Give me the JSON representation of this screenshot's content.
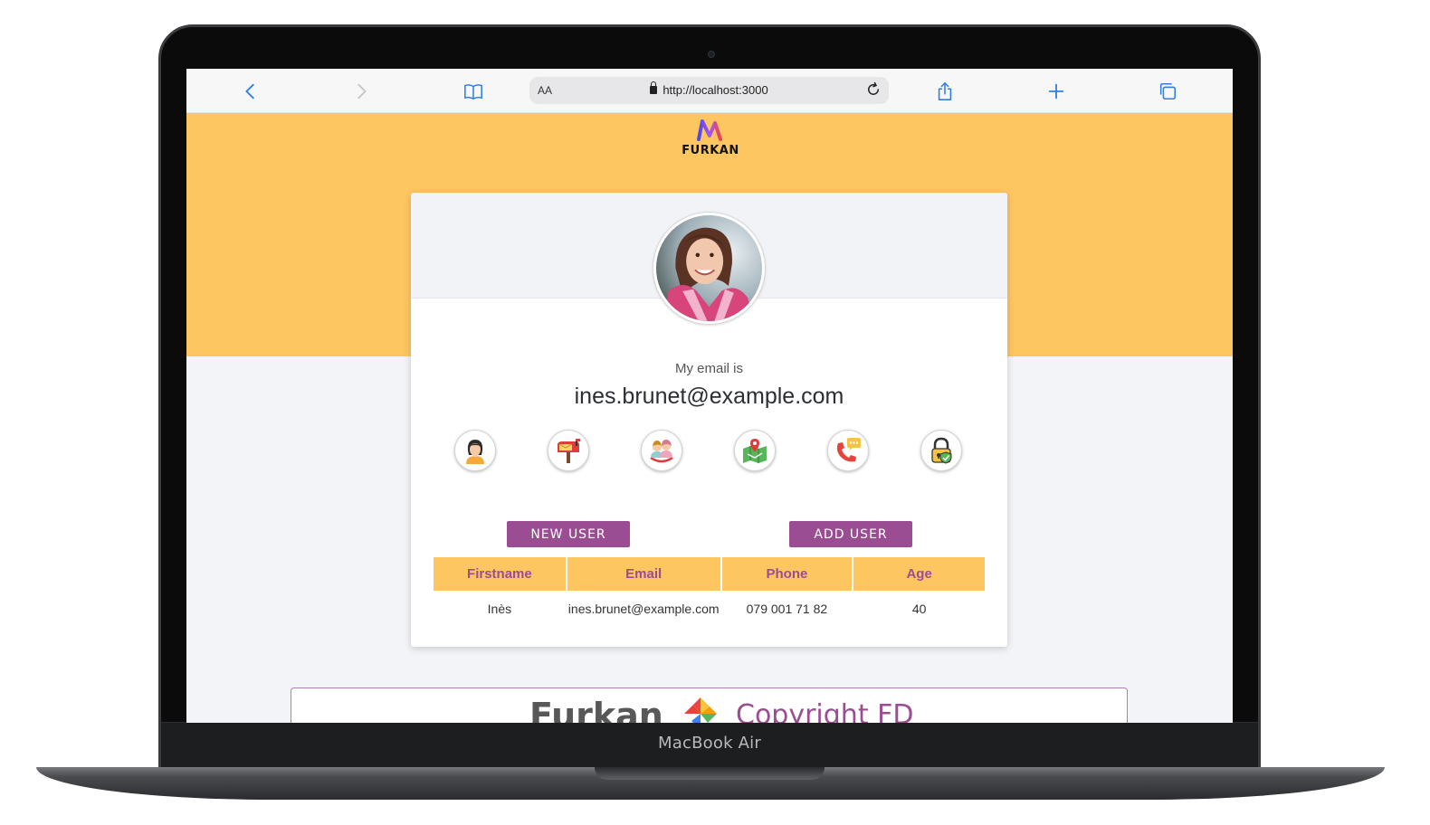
{
  "device": {
    "model_label": "MacBook Air"
  },
  "browser": {
    "text_size_label": "AA",
    "url": "http://localhost:3000",
    "icons": {
      "back": "chevron-left-icon",
      "forward": "chevron-right-icon",
      "bookmarks": "book-icon",
      "reload": "reload-icon",
      "share": "share-icon",
      "new_tab": "plus-icon",
      "tabs": "tabs-icon"
    }
  },
  "header": {
    "logo_text": "FURKAN"
  },
  "profile": {
    "email_label": "My email is",
    "email_value": "ines.brunet@example.com",
    "info_icons": [
      "user-icon",
      "mailbox-icon",
      "age-icon",
      "map-icon",
      "phone-icon",
      "lock-icon"
    ]
  },
  "buttons": {
    "new_user": "NEW USER",
    "add_user": "ADD USER"
  },
  "table": {
    "headers": [
      "Firstname",
      "Email",
      "Phone",
      "Age"
    ],
    "rows": [
      {
        "firstname": "Inès",
        "email": "ines.brunet@example.com",
        "phone": "079 001 71 82",
        "age": "40"
      }
    ]
  },
  "footer": {
    "brand": "Furkan",
    "copyright": "Copyright FD"
  },
  "colors": {
    "accent_yellow": "#fec661",
    "accent_purple": "#9b4d93",
    "background": "#f2f4f7"
  }
}
